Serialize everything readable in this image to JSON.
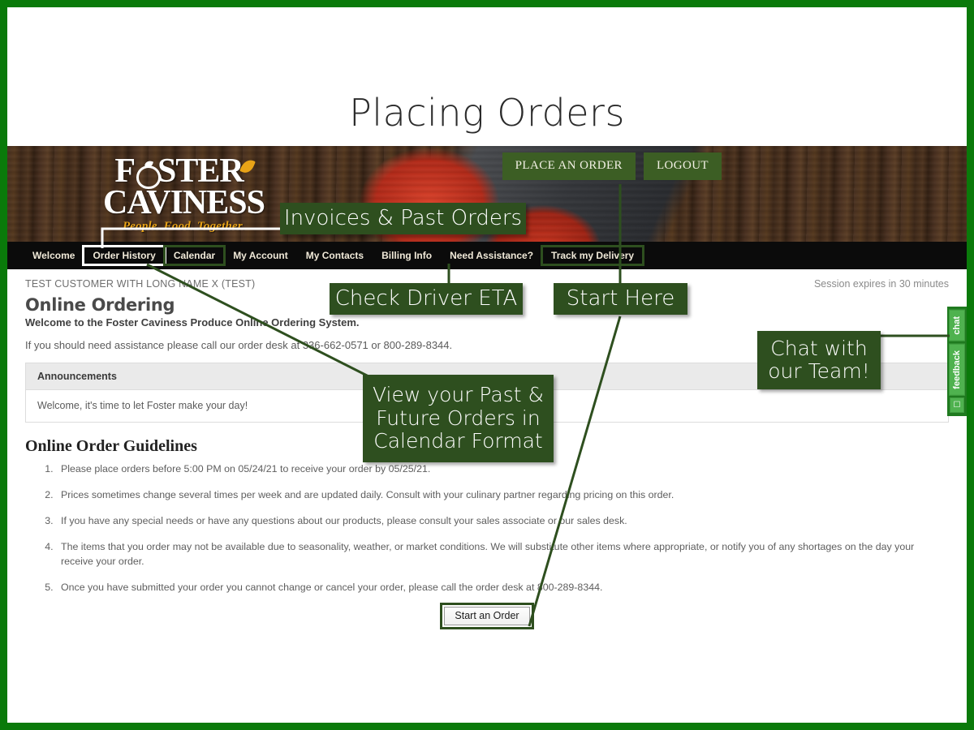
{
  "slide": {
    "title": "Placing Orders",
    "border_color": "#0a7a0a",
    "callout_color": "#2e4f1f"
  },
  "site_header": {
    "logo": {
      "line1": "F STER",
      "line2": "CAVINESS",
      "tagline": "People. Food. Together."
    },
    "buttons": [
      {
        "label": "PLACE AN ORDER"
      },
      {
        "label": "LOGOUT"
      }
    ]
  },
  "nav": {
    "items": [
      {
        "label": "Welcome",
        "highlight": "none"
      },
      {
        "label": "Order History",
        "highlight": "white"
      },
      {
        "label": "Calendar",
        "highlight": "green"
      },
      {
        "label": "My Account",
        "highlight": "none"
      },
      {
        "label": "My Contacts",
        "highlight": "none"
      },
      {
        "label": "Billing Info",
        "highlight": "none"
      },
      {
        "label": "Need Assistance?",
        "highlight": "none"
      },
      {
        "label": "Track my Delivery",
        "highlight": "green"
      }
    ]
  },
  "account_bar": {
    "customer": "TEST CUSTOMER WITH LONG NAME X (TEST)",
    "session": "Session expires in 30 minutes"
  },
  "main": {
    "heading": "Online Ordering",
    "welcome": "Welcome to the Foster Caviness Produce Online Ordering System.",
    "assistance": "If you should need assistance please call our order desk at 336-662-0571 or 800-289-8344.",
    "announcements": {
      "header": "Announcements",
      "body": "Welcome, it's time to let Foster make your day!"
    },
    "guidelines_heading": "Online Order Guidelines",
    "guidelines": [
      "Please place orders before 5:00 PM on 05/24/21 to receive your order by 05/25/21.",
      "Prices sometimes change several times per week and are updated daily. Consult with your culinary partner regarding pricing on this order.",
      "If you have any special needs or have any questions about our products, please consult your sales associate or our sales desk.",
      "The items that you order may not be available due to seasonality, weather, or market conditions. We will substitute other items where appropriate, or notify you of any shortages on the day your receive your order.",
      "Once you have submitted your order you cannot change or cancel your order, please call the order desk at 800-289-8344."
    ],
    "start_button": "Start an Order"
  },
  "side_tabs": {
    "chat": "chat",
    "feedback": "feedback"
  },
  "callouts": [
    {
      "id": "invoices",
      "text": "Invoices & Past Orders"
    },
    {
      "id": "check_driver",
      "text": "Check Driver ETA"
    },
    {
      "id": "start_here",
      "text": "Start Here"
    },
    {
      "id": "view_calendar",
      "text": "View your Past &\nFuture Orders in\nCalendar Format"
    },
    {
      "id": "chat_team",
      "text": "Chat with\nour Team!"
    }
  ]
}
